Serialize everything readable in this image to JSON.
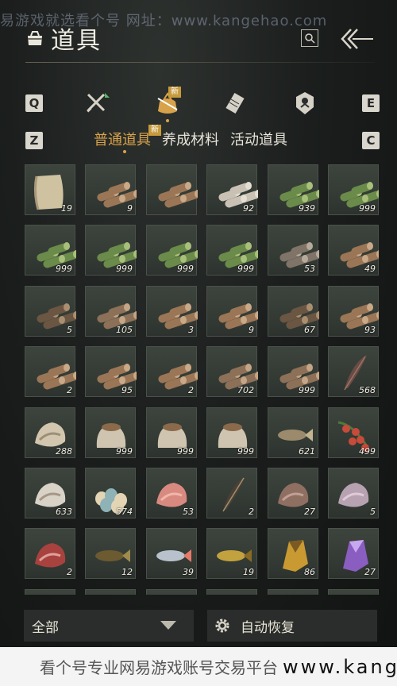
{
  "watermark_top": "易游戏就选看个号   网址：www.kangehao.com",
  "header": {
    "title": "道具"
  },
  "keys": {
    "prev_cat": "Q",
    "next_cat": "E",
    "prev_sub": "Z",
    "next_sub": "C"
  },
  "categories": [
    {
      "icon": "crossed-swords-icon",
      "active": false
    },
    {
      "icon": "gold-pouch-icon",
      "active": true,
      "badge": "新"
    },
    {
      "icon": "scroll-icon",
      "active": false
    },
    {
      "icon": "shield-emblem-icon",
      "active": false
    }
  ],
  "subtabs": [
    {
      "label": "普通道具",
      "active": true,
      "badge": "新"
    },
    {
      "label": "养成材料",
      "active": false
    },
    {
      "label": "活动道具",
      "active": false
    }
  ],
  "items": [
    {
      "icon": "paper-scroll-icon",
      "count": "19"
    },
    {
      "icon": "log-pile-icon",
      "count": "9"
    },
    {
      "icon": "log-pile-icon",
      "count": ""
    },
    {
      "icon": "birch-log-icon",
      "count": "92"
    },
    {
      "icon": "bamboo-bundle-icon",
      "count": "939"
    },
    {
      "icon": "bamboo-bundle-icon",
      "count": "999"
    },
    {
      "icon": "bamboo-bundle-icon",
      "count": "999"
    },
    {
      "icon": "bamboo-bundle-icon",
      "count": "999"
    },
    {
      "icon": "bamboo-bundle-icon",
      "count": "999"
    },
    {
      "icon": "bamboo-bundle-icon",
      "count": "999"
    },
    {
      "icon": "grey-log-pile-icon",
      "count": "53"
    },
    {
      "icon": "log-pile-icon",
      "count": "49"
    },
    {
      "icon": "dark-log-pile-icon",
      "count": "5"
    },
    {
      "icon": "firewood-stack-icon",
      "count": "105"
    },
    {
      "icon": "log-pile-icon",
      "count": "3"
    },
    {
      "icon": "log-pile-icon",
      "count": "9"
    },
    {
      "icon": "dark-log-pile-icon",
      "count": "67"
    },
    {
      "icon": "log-pile-icon",
      "count": "93"
    },
    {
      "icon": "log-pile-icon",
      "count": "2"
    },
    {
      "icon": "log-pile-icon",
      "count": "95"
    },
    {
      "icon": "log-pile-icon",
      "count": "2"
    },
    {
      "icon": "firewood-stack-icon",
      "count": "702"
    },
    {
      "icon": "firewood-stack-icon",
      "count": "999"
    },
    {
      "icon": "feather-icon",
      "count": "568"
    },
    {
      "icon": "oyster-icon",
      "count": "288"
    },
    {
      "icon": "grain-sack-icon",
      "count": "999"
    },
    {
      "icon": "grain-sack-icon",
      "count": "999"
    },
    {
      "icon": "grain-sack-icon",
      "count": "999"
    },
    {
      "icon": "fish-icon",
      "count": "621"
    },
    {
      "icon": "berry-branch-icon",
      "count": "499"
    },
    {
      "icon": "mushroom-icon",
      "count": "633"
    },
    {
      "icon": "eggs-icon",
      "count": "574"
    },
    {
      "icon": "raw-meat-chunks-icon",
      "count": "53"
    },
    {
      "icon": "feather-fan-icon",
      "count": "2"
    },
    {
      "icon": "animal-hide-icon",
      "count": "27"
    },
    {
      "icon": "cloth-bundle-icon",
      "count": "5"
    },
    {
      "icon": "steak-icon",
      "count": "2"
    },
    {
      "icon": "catfish-icon",
      "count": "12"
    },
    {
      "icon": "salmon-icon",
      "count": "39"
    },
    {
      "icon": "carp-icon",
      "count": "19"
    },
    {
      "icon": "gold-ore-icon",
      "count": "86"
    },
    {
      "icon": "amethyst-crystal-icon",
      "count": "27"
    }
  ],
  "bottom": {
    "filter_label": "全部",
    "restore_label": "自动恢复"
  },
  "footer_watermark": {
    "text": "看个号专业网易游戏账号交易平台",
    "url": "www.kangehao.com"
  },
  "colors": {
    "accent": "#d8a24a",
    "badge": "#c79a3c"
  }
}
